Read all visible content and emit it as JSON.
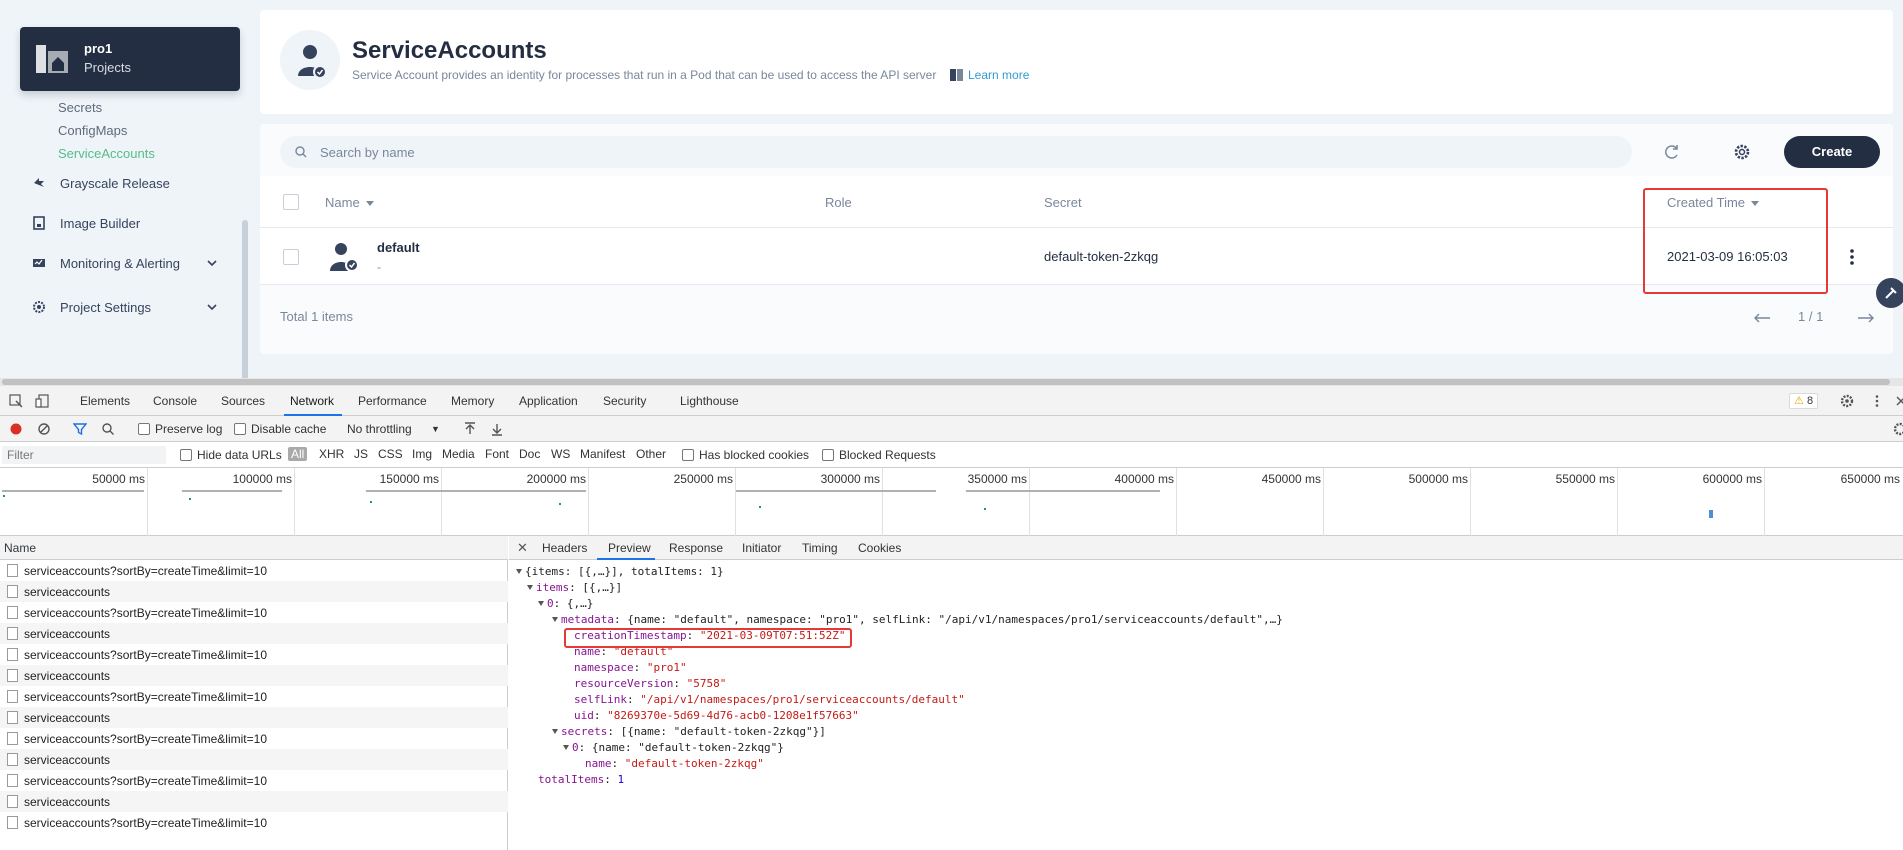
{
  "app": {
    "project": {
      "name": "pro1",
      "type": "Projects"
    },
    "nav": {
      "sub_items": [
        {
          "label": "Secrets",
          "active": false
        },
        {
          "label": "ConfigMaps",
          "active": false
        },
        {
          "label": "ServiceAccounts",
          "active": true
        }
      ],
      "items": [
        {
          "label": "Grayscale Release",
          "icon": "grayscale-icon",
          "expandable": false
        },
        {
          "label": "Image Builder",
          "icon": "image-builder-icon",
          "expandable": false
        },
        {
          "label": "Monitoring & Alerting",
          "icon": "monitoring-icon",
          "expandable": true
        },
        {
          "label": "Project Settings",
          "icon": "gear-icon",
          "expandable": true
        }
      ]
    },
    "header": {
      "title": "ServiceAccounts",
      "description": "Service Account provides an identity for processes that run in a Pod that can be used to access the API server",
      "learn_more": "Learn more"
    },
    "toolbar": {
      "search_placeholder": "Search by name",
      "create_label": "Create"
    },
    "table": {
      "columns": {
        "name": "Name",
        "role": "Role",
        "secret": "Secret",
        "created": "Created Time"
      },
      "rows": [
        {
          "name": "default",
          "desc": "-",
          "role": "",
          "secret": "default-token-2zkqg",
          "created": "2021-03-09 16:05:03"
        }
      ],
      "total": "Total 1 items",
      "pagination": "1 / 1"
    },
    "colors": {
      "accent_green": "#55bc8a",
      "dark": "#242e42",
      "highlight": "#e53935"
    }
  },
  "devtools": {
    "tabs": [
      "Elements",
      "Console",
      "Sources",
      "Network",
      "Performance",
      "Memory",
      "Application",
      "Security",
      "Lighthouse"
    ],
    "active_tab": "Network",
    "warning_count": "8",
    "toolbar": {
      "preserve_log": "Preserve log",
      "disable_cache": "Disable cache",
      "throttling": "No throttling"
    },
    "filter": {
      "placeholder": "Filter",
      "hide_data_urls": "Hide data URLs",
      "types": [
        "All",
        "XHR",
        "JS",
        "CSS",
        "Img",
        "Media",
        "Font",
        "Doc",
        "WS",
        "Manifest",
        "Other"
      ],
      "has_blocked_cookies": "Has blocked cookies",
      "blocked_requests": "Blocked Requests"
    },
    "overview_ticks": [
      "50000 ms",
      "100000 ms",
      "150000 ms",
      "200000 ms",
      "250000 ms",
      "300000 ms",
      "350000 ms",
      "400000 ms",
      "450000 ms",
      "500000 ms",
      "550000 ms",
      "600000 ms",
      "650000 ms"
    ],
    "requests_header": "Name",
    "requests": [
      "serviceaccounts?sortBy=createTime&limit=10",
      "serviceaccounts",
      "serviceaccounts?sortBy=createTime&limit=10",
      "serviceaccounts",
      "serviceaccounts?sortBy=createTime&limit=10",
      "serviceaccounts",
      "serviceaccounts?sortBy=createTime&limit=10",
      "serviceaccounts",
      "serviceaccounts?sortBy=createTime&limit=10",
      "serviceaccounts",
      "serviceaccounts?sortBy=createTime&limit=10",
      "serviceaccounts",
      "serviceaccounts?sortBy=createTime&limit=10"
    ],
    "detail_tabs": [
      "Headers",
      "Preview",
      "Response",
      "Initiator",
      "Timing",
      "Cookies"
    ],
    "active_detail_tab": "Preview",
    "preview": {
      "root_summary": "{items: [{,…}], totalItems: 1}",
      "items_key": "items",
      "items_summary": "[{,…}]",
      "idx0_key": "0",
      "idx0_summary": "{,…}",
      "metadata_key": "metadata",
      "metadata_summary": "{name: \"default\", namespace: \"pro1\", selfLink: \"/api/v1/namespaces/pro1/serviceaccounts/default\",…}",
      "creationTimestamp_key": "creationTimestamp",
      "creationTimestamp": "\"2021-03-09T07:51:52Z\"",
      "name_key": "name",
      "name": "\"default\"",
      "namespace_key": "namespace",
      "namespace": "\"pro1\"",
      "resourceVersion_key": "resourceVersion",
      "resourceVersion": "\"5758\"",
      "selfLink_key": "selfLink",
      "selfLink": "\"/api/v1/namespaces/pro1/serviceaccounts/default\"",
      "uid_key": "uid",
      "uid": "\"8269370e-5d69-4d76-acb0-1208e1f57663\"",
      "secrets_key": "secrets",
      "secrets_summary": "[{name: \"default-token-2zkqg\"}]",
      "s0_key": "0",
      "s0_summary": "{name: \"default-token-2zkqg\"}",
      "s0_name_key": "name",
      "s0_name": "\"default-token-2zkqg\"",
      "totalItems_key": "totalItems",
      "totalItems": "1"
    }
  }
}
